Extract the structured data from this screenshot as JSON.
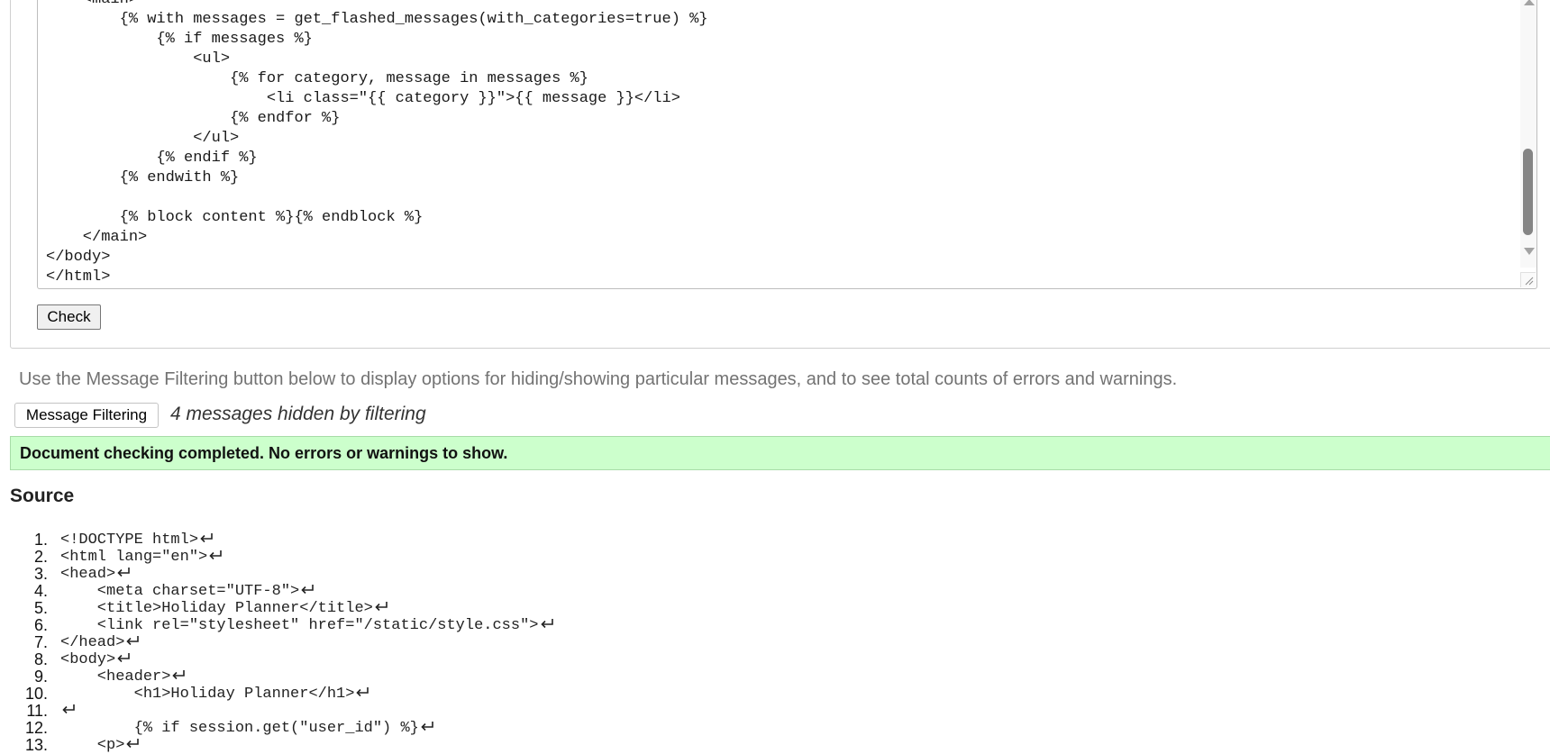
{
  "editor": {
    "lines": [
      "    <main>",
      "        {% with messages = get_flashed_messages(with_categories=true) %}",
      "            {% if messages %}",
      "                <ul>",
      "                    {% for category, message in messages %}",
      "                        <li class=\"{{ category }}\">{{ message }}</li>",
      "                    {% endfor %}",
      "                </ul>",
      "            {% endif %}",
      "        {% endwith %}",
      "",
      "        {% block content %}{% endblock %}",
      "    </main>",
      "</body>",
      "</html>"
    ]
  },
  "check_button_label": "Check",
  "filter_note": "Use the Message Filtering button below to display options for hiding/showing particular messages, and to see total counts of errors and warnings.",
  "filter_button_label": "Message Filtering",
  "hidden_messages_note": "4 messages hidden by filtering",
  "result_banner": "Document checking completed. No errors or warnings to show.",
  "source_heading": "Source",
  "source": {
    "lines": [
      {
        "num": "1.",
        "code": "<!DOCTYPE html>"
      },
      {
        "num": "2.",
        "code": "<html lang=\"en\">"
      },
      {
        "num": "3.",
        "code": "<head>"
      },
      {
        "num": "4.",
        "code": "    <meta charset=\"UTF-8\">"
      },
      {
        "num": "5.",
        "code": "    <title>Holiday Planner</title>"
      },
      {
        "num": "6.",
        "code": "    <link rel=\"stylesheet\" href=\"/static/style.css\">"
      },
      {
        "num": "7.",
        "code": "</head>"
      },
      {
        "num": "8.",
        "code": "<body>"
      },
      {
        "num": "9.",
        "code": "    <header>"
      },
      {
        "num": "10.",
        "code": "        <h1>Holiday Planner</h1>"
      },
      {
        "num": "11.",
        "code": ""
      },
      {
        "num": "12.",
        "code": "        {% if session.get(\"user_id\") %}"
      },
      {
        "num": "13.",
        "code": "    <p>"
      }
    ]
  },
  "colors": {
    "success_background": "#ccffcc",
    "muted_text": "#737373"
  },
  "icons": {
    "line_end": "return-arrow-icon"
  }
}
